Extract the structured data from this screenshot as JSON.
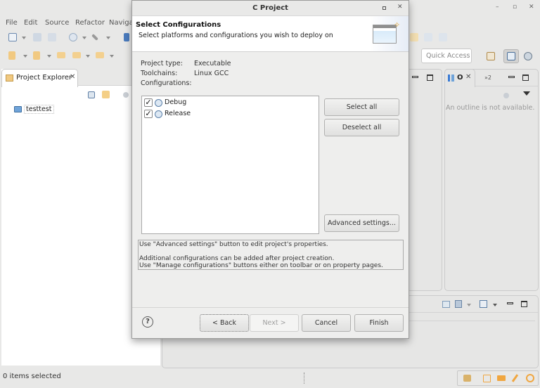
{
  "ide": {
    "menu": [
      "File",
      "Edit",
      "Source",
      "Refactor",
      "Navigat"
    ],
    "window_controls": [
      "minimize",
      "maximize",
      "close"
    ],
    "quick_access_placeholder": "Quick Access",
    "project_explorer": {
      "tab_label": "Project Explorer",
      "tree": [
        {
          "label": "testtest",
          "icon": "project-folder-icon"
        }
      ]
    },
    "outline": {
      "tab_label": "O",
      "overflow_label": "»2",
      "empty_message": "An outline is not available."
    },
    "status_bar": {
      "text": "0 items selected"
    }
  },
  "dialog": {
    "title": "C Project",
    "header": {
      "title": "Select Configurations",
      "subtitle": "Select platforms and configurations you wish to deploy on"
    },
    "fields": [
      {
        "label": "Project type:",
        "value": "Executable"
      },
      {
        "label": "Toolchains:",
        "value": "Linux GCC"
      },
      {
        "label": "Configurations:",
        "value": ""
      }
    ],
    "configurations": [
      {
        "label": "Debug",
        "checked": true
      },
      {
        "label": "Release",
        "checked": true
      }
    ],
    "side_buttons": {
      "select_all": "Select all",
      "deselect_all": "Deselect all",
      "advanced": "Advanced settings..."
    },
    "info_lines": [
      "Use \"Advanced settings\" button to edit project's properties.",
      "",
      "Additional configurations can be added after project creation.",
      "Use \"Manage configurations\" buttons either on toolbar or on property pages."
    ],
    "footer": {
      "help": "?",
      "back": "< Back",
      "next": "Next >",
      "cancel": "Cancel",
      "finish": "Finish"
    }
  }
}
